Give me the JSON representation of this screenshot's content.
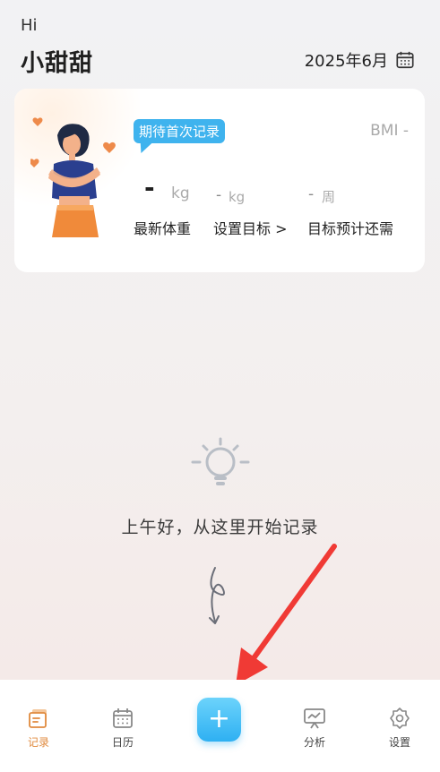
{
  "header": {
    "greeting": "Hi",
    "username": "小甜甜",
    "date": "2025年6月",
    "calendar_icon": "calendar-icon"
  },
  "card": {
    "badge": "期待首次记录",
    "bmi": "BMI -",
    "latest_weight": {
      "value": "-",
      "unit": "kg",
      "label": "最新体重"
    },
    "goal": {
      "value": "-",
      "unit": "kg",
      "label": "设置目标 >"
    },
    "eta": {
      "value": "-",
      "unit": "周",
      "label": "目标预计还需"
    }
  },
  "empty_state": {
    "icon": "lightbulb-icon",
    "message": "上午好，从这里开始记录"
  },
  "nav": {
    "items": [
      {
        "label": "记录",
        "icon": "record-icon",
        "active": true
      },
      {
        "label": "日历",
        "icon": "calendar-icon"
      },
      {
        "label": "+",
        "icon": "plus-icon"
      },
      {
        "label": "分析",
        "icon": "analysis-icon"
      },
      {
        "label": "设置",
        "icon": "settings-icon"
      }
    ]
  },
  "colors": {
    "accent_blue": "#3fb3ee",
    "active_orange": "#e08a3e",
    "arrow_red": "#f03a35"
  }
}
